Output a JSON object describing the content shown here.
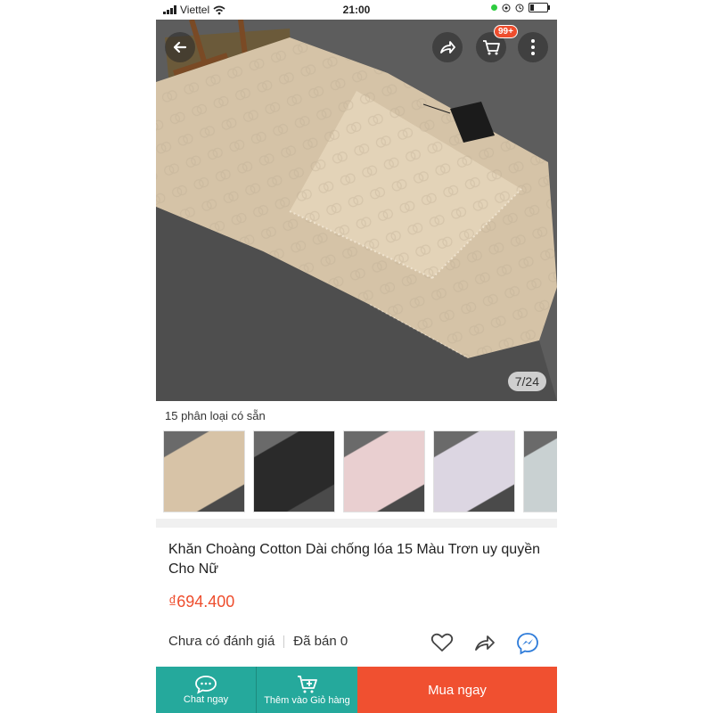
{
  "status_bar": {
    "carrier": "Viettel",
    "time": "21:00"
  },
  "header": {
    "cart_badge": "99+"
  },
  "gallery": {
    "counter": "7/24"
  },
  "variants": {
    "label": "15 phân loại có sẵn",
    "swatches": [
      "#d7c3a7",
      "#2a2a2a",
      "#e9cfd0",
      "#dcd6e2",
      "#c9d1d2"
    ]
  },
  "product": {
    "title": "Khăn Choàng Cotton Dài chống lóa 15 Màu Trơn uy quyền Cho Nữ",
    "price": "₫694.400",
    "rating_text": "Chưa có đánh giá",
    "sold_text": "Đã bán 0"
  },
  "bottom_bar": {
    "chat_label": "Chat ngay",
    "cart_label": "Thêm vào Giỏ hàng",
    "buy_label": "Mua ngay"
  },
  "colors": {
    "accent": "#ee4d2d",
    "teal": "#25a99c",
    "buy": "#f05030"
  },
  "icons": [
    "back-arrow-icon",
    "share-icon",
    "cart-icon",
    "more-vertical-icon",
    "heart-icon",
    "messenger-icon",
    "chat-icon",
    "add-cart-icon"
  ]
}
